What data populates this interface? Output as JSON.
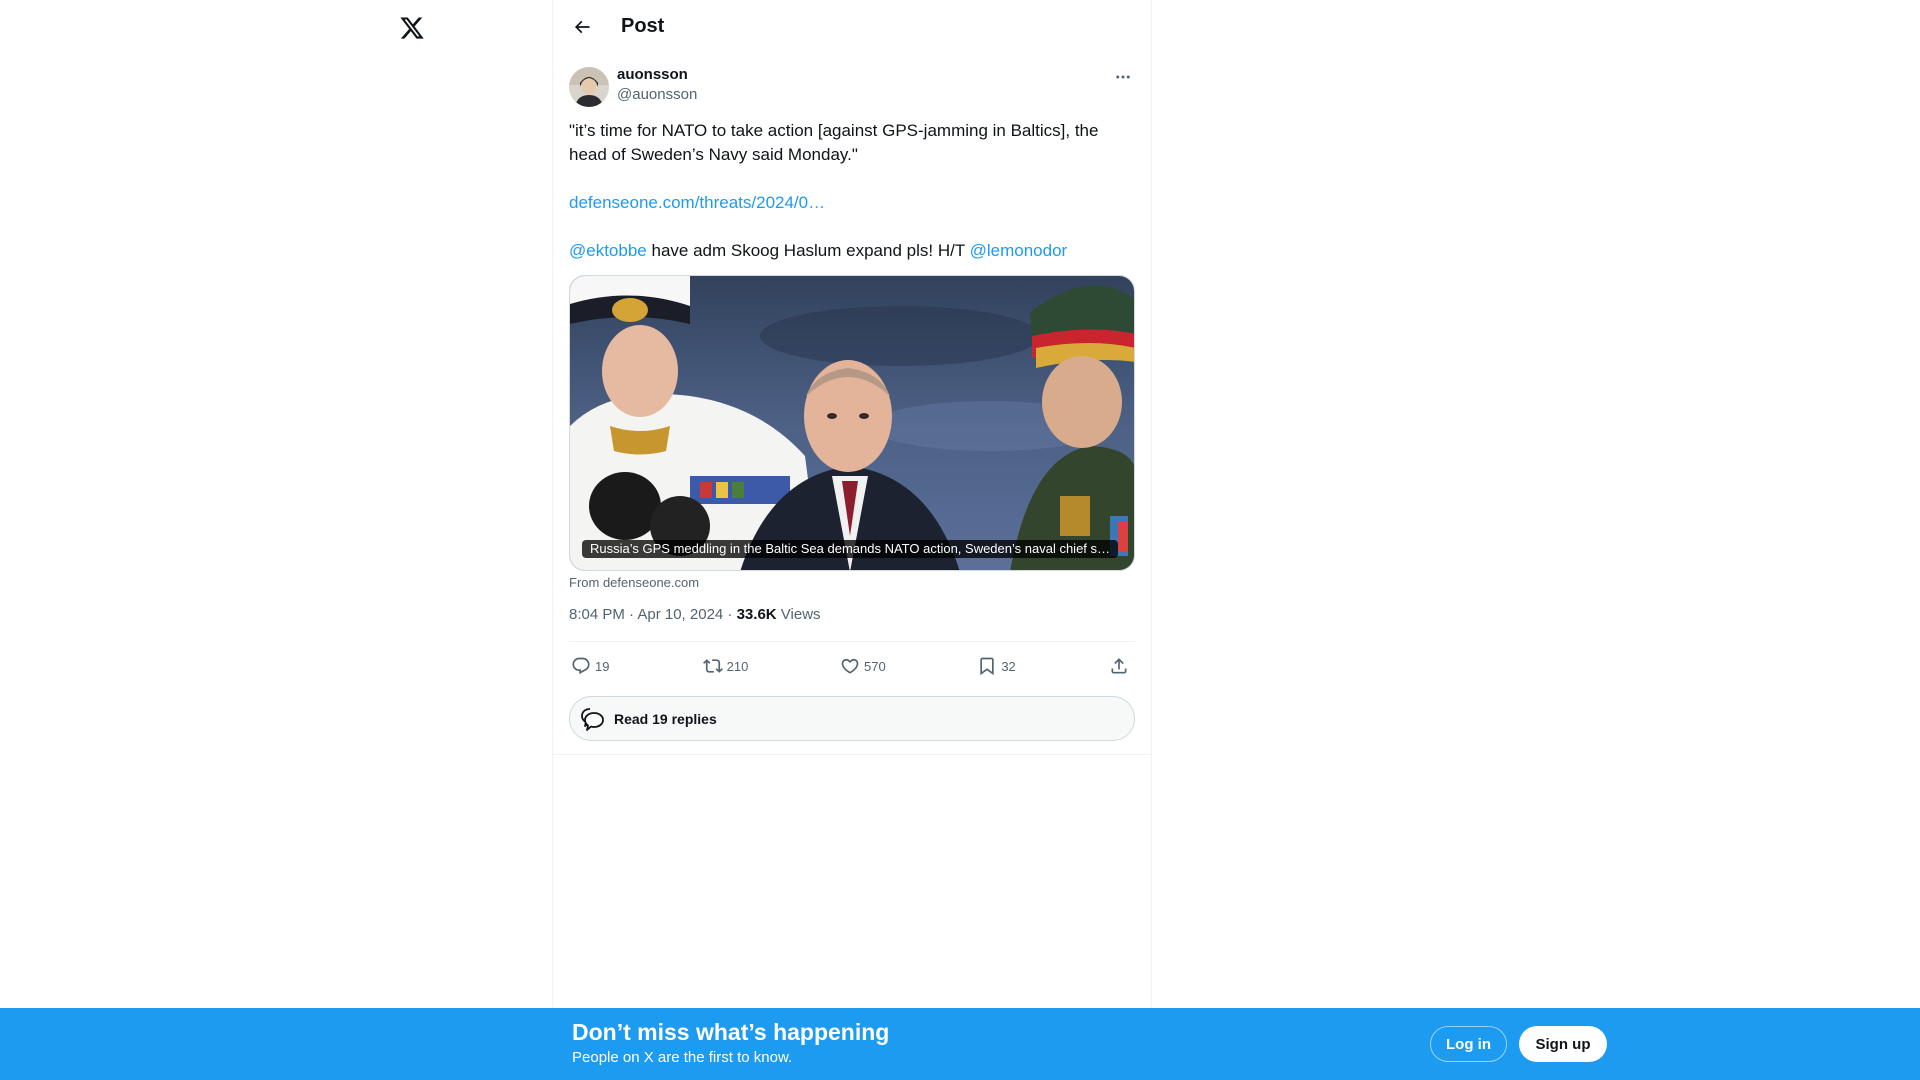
{
  "colors": {
    "accent": "#1d9bf0",
    "text": "#0f1419",
    "secondary": "#536471",
    "border": "#cfd9de"
  },
  "nav": {
    "logo_icon": "x-logo-icon"
  },
  "header": {
    "title": "Post",
    "back_icon": "arrow-left-icon"
  },
  "post": {
    "author": {
      "display_name": "auonsson",
      "handle": "@auonsson"
    },
    "text": {
      "quote": "\"it’s time for NATO to take action [against GPS-jamming in Baltics], the head of Sweden’s Navy said Monday.\"",
      "link": "defenseone.com/threats/2024/0…",
      "mention_1": "@ektobbe",
      "middle": " have adm Skoog Haslum expand pls! H/T ",
      "mention_2": "@lemonodor"
    },
    "card": {
      "caption": "Russia’s GPS meddling in the Baltic Sea demands NATO action, Sweden’s naval chief s…",
      "from_prefix": "From ",
      "from_domain": "defenseone.com"
    },
    "meta": {
      "time": "8:04 PM · Apr 10, 2024 · ",
      "views_count": "33.6K",
      "views_label": " Views"
    },
    "actions": {
      "replies": "19",
      "reposts": "210",
      "likes": "570",
      "bookmarks": "32"
    },
    "read_replies_label": "Read 19 replies"
  },
  "banner": {
    "title": "Don’t miss what’s happening",
    "subtitle": "People on X are the first to know.",
    "login_label": "Log in",
    "signup_label": "Sign up"
  }
}
